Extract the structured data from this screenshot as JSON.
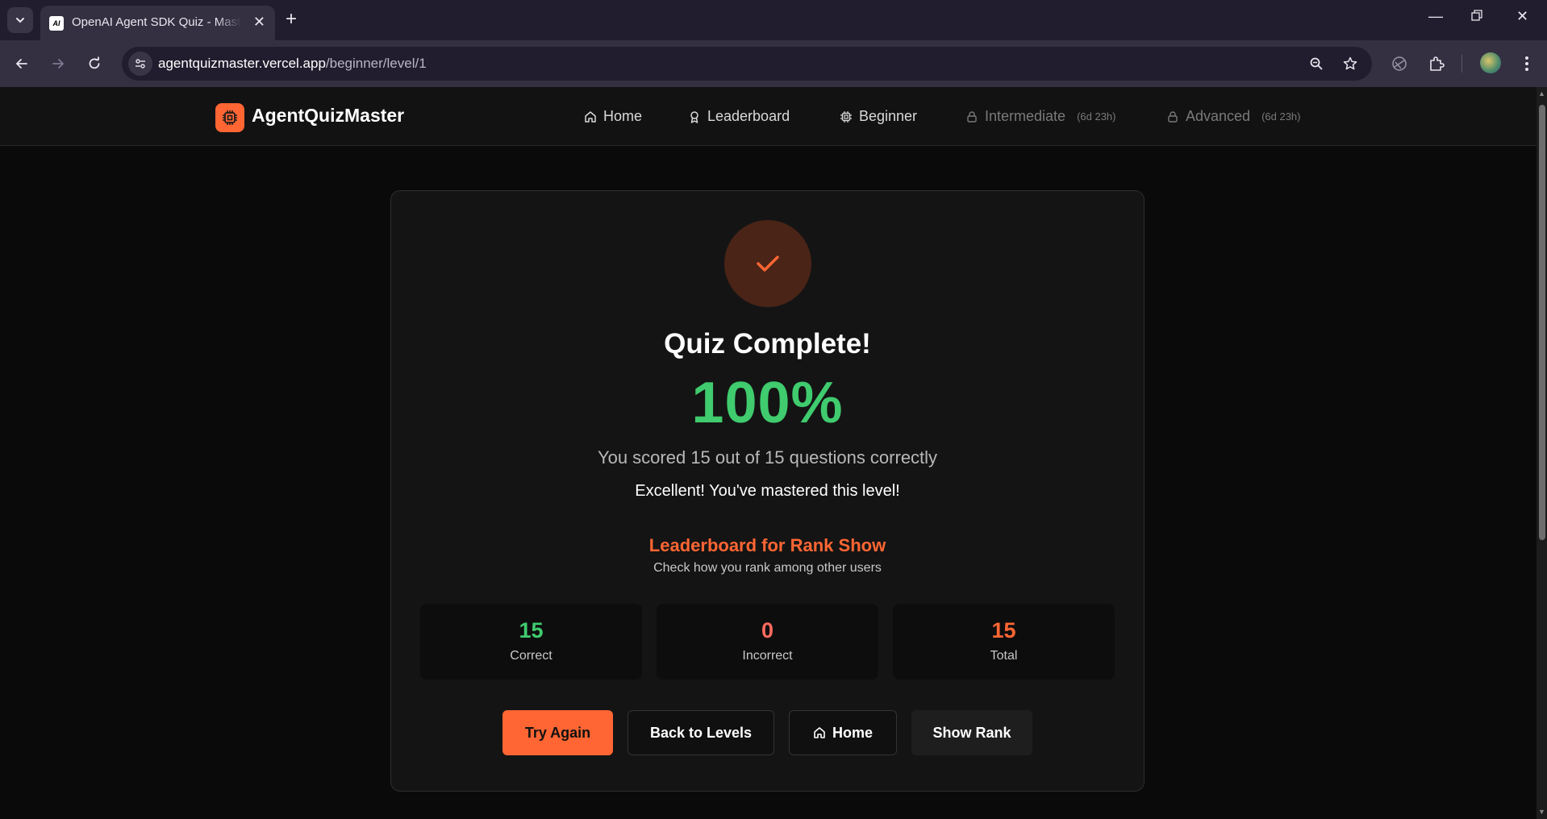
{
  "browser": {
    "tab_title": "OpenAI Agent SDK Quiz - Master",
    "favicon_text": "AI",
    "url_host": "agentquizmaster.vercel.app",
    "url_path": "/beginner/level/1"
  },
  "header": {
    "brand": "AgentQuizMaster",
    "nav": {
      "home": "Home",
      "leaderboard": "Leaderboard",
      "beginner": "Beginner",
      "intermediate": "Intermediate",
      "intermediate_badge": "(6d 23h)",
      "advanced": "Advanced",
      "advanced_badge": "(6d 23h)"
    }
  },
  "result": {
    "title": "Quiz Complete!",
    "percent": "100%",
    "summary": "You scored 15 out of 15 questions correctly",
    "praise": "Excellent! You've mastered this level!",
    "leaderboard_title": "Leaderboard for Rank Show",
    "leaderboard_sub": "Check how you rank among other users"
  },
  "stats": {
    "correct": {
      "value": "15",
      "label": "Correct"
    },
    "incorrect": {
      "value": "0",
      "label": "Incorrect"
    },
    "total": {
      "value": "15",
      "label": "Total"
    }
  },
  "actions": {
    "try_again": "Try Again",
    "back_to_levels": "Back to Levels",
    "home": "Home",
    "show_rank": "Show Rank"
  },
  "colors": {
    "accent": "#ff6633",
    "success": "#3fcb6e",
    "danger": "#ff6b5e",
    "background": "#0a0a0a",
    "card": "#141414"
  },
  "icons": {
    "logo": "cpu-chip-icon",
    "home": "house-icon",
    "leaderboard": "award-icon",
    "beginner": "cpu-chip-icon",
    "locked": "lock-icon",
    "success": "check-icon"
  }
}
